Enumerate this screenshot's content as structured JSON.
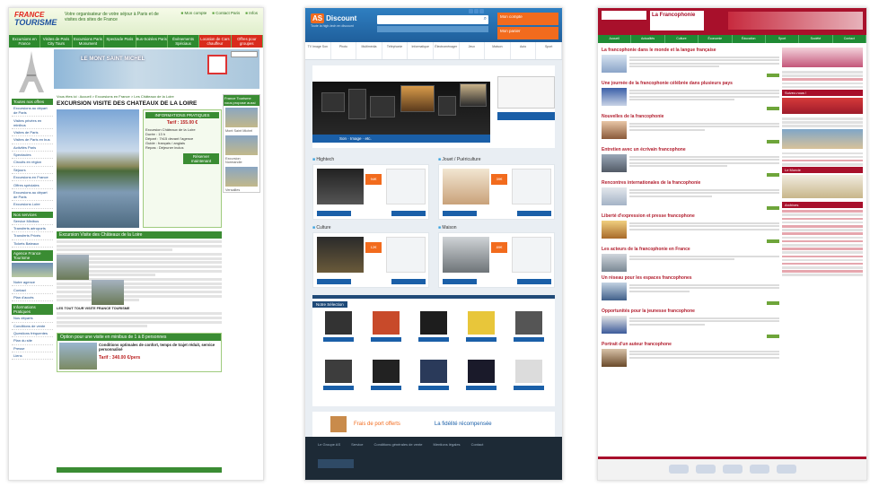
{
  "site_a": {
    "logo_line1": "FRANCE",
    "logo_line2": "TOURISME",
    "slogan": "Votre organisateur de votre séjour à Paris et de visites des sites de France",
    "top_links": [
      "Mon compte",
      "Contact Paris",
      "Infos"
    ],
    "nav": [
      "Excursions en France",
      "Visites de Paris City Tours",
      "Excursions Paris Monument",
      "Spectacle Paris",
      "Bus-Soirées Paris",
      "Évènements Spéciaux",
      "Location de Cars chauffeur",
      "Offres pour groupes"
    ],
    "banner_text": "LE MONT SAINT MICHEL",
    "breadcrumb": "Vous êtes ici : Accueil > Excursions en France > Les Châteaux de la Loire",
    "sidebar_sections": [
      {
        "title": "Toutes nos offres",
        "items": [
          "Excursions au départ de Paris",
          "Visites privées en minibus",
          "Visites de Paris",
          "Visites de Paris en bus",
          "Activités Paris",
          "Spectacles",
          "Circuits en région",
          "Séjours",
          "Excursions en France",
          "Offres spéciales",
          "Excursions au départ de Paris",
          "Excursions Loire"
        ]
      },
      {
        "title": "Nos services",
        "items": [
          "Service Minibus",
          "Transferts aéroports",
          "Transferts Privés",
          "Tickets Bateaux"
        ]
      },
      {
        "title": "Agence France Tourisme",
        "items": [
          "Notre agence",
          "Contact",
          "Plan d'accès"
        ]
      },
      {
        "title": "Informations Pratiques",
        "items": [
          "Nos départs",
          "Conditions de vente",
          "Questions fréquentes",
          "Plan du site",
          "Presse",
          "Liens"
        ]
      }
    ],
    "page_title": "EXCURSION VISITE DES CHATEAUX DE LA LOIRE",
    "info_box": {
      "header": "INFORMATIONS PRATIQUES",
      "price": "Tarif : 155.00 €",
      "rows": [
        "Excursion Châteaux de la Loire",
        "Durée : 13 h",
        "Départ : 7h15 devant l'agence",
        "Guide : français / anglais",
        "Repas : Déjeuner inclus"
      ],
      "book_button": "Réserver maintenant"
    },
    "section_heading": "Excursion Visite des Châteaux de la Loire",
    "subsection_heading": "LES TOUT TOUR VISITE FRANCE TOURISME",
    "offer_heading": "Option pour une visite en minibus de 1 à 8 personnes",
    "offer_title": "Conditions optimales de confort, temps de trajet réduit, service personnalisé",
    "offer_price": "Tarif : 340.00 €/pers",
    "right_box_title": "France Tourisme vous propose aussi",
    "right_items": [
      "Mont Saint Michel",
      "Excursion Normandie",
      "Versailles"
    ]
  },
  "site_b": {
    "logo_as": "AS",
    "logo_name": "Discount",
    "tagline": "Toute la high-tech en discount",
    "search_placeholder": "",
    "cta_account": "Mon compte",
    "cta_cart": "Mon panier",
    "categories": [
      "TV Image Son",
      "Photo",
      "Multimédia",
      "Téléphonie",
      "Informatique",
      "Électroménager",
      "Jeux",
      "Maison",
      "Auto",
      "Sport"
    ],
    "hero_caption": "Son · Image · etc.",
    "sections": [
      {
        "label": "Hightech",
        "price": "94€"
      },
      {
        "label": "Jouet / Puériculture",
        "price": "39€"
      },
      {
        "label": "Culture",
        "price": "12€"
      },
      {
        "label": "Maison",
        "price": "89€"
      }
    ],
    "selection_title": "Notre Sélection",
    "free_shipping": "Frais de port offerts",
    "loyalty": "La fidélité récompensée",
    "footer_links": [
      "Le Groupe AS",
      "Service",
      "Conditions générales de vente",
      "Mentions légales",
      "Contact"
    ]
  },
  "site_c": {
    "logo": "La Francophonie",
    "nav": [
      "Accueil",
      "Actualités",
      "Culture",
      "Économie",
      "Éducation",
      "Sport",
      "Société",
      "Contact"
    ],
    "articles": [
      "La francophonie dans le monde et la langue française",
      "Une journée de la francophonie célébrée dans plusieurs pays",
      "Nouvelles de la francophonie",
      "Entretien avec un écrivain francophone",
      "Rencontres internationales de la francophonie",
      "Liberté d'expression et presse francophone",
      "Les acteurs de la francophonie en France",
      "Un réseau pour les espaces francophones",
      "Opportunités pour la jeunesse francophone",
      "Portrait d'un auteur francophone"
    ],
    "side_heading": "Suivez-nous !",
    "side_heading2": "Le Monde",
    "side_heading3": "Archives"
  }
}
